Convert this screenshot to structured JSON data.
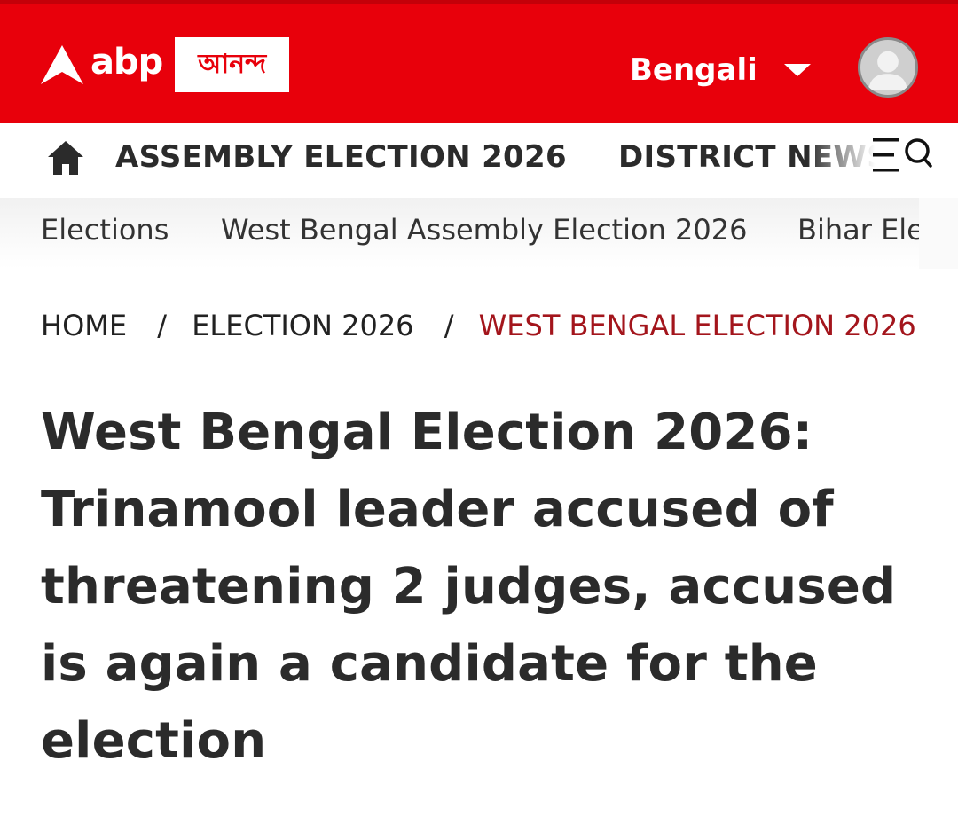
{
  "header": {
    "logo_text": "abp",
    "logo_badge": "আনন্দ",
    "language_label": "Bengali",
    "brand_color": "#e8000b"
  },
  "nav": {
    "items": [
      {
        "label": "ASSEMBLY ELECTION 2026"
      },
      {
        "label": "DISTRICT NEWS"
      }
    ],
    "icons": {
      "home": "home-icon",
      "menu": "menu-icon",
      "search": "search-icon"
    }
  },
  "subnav": {
    "items": [
      {
        "label": "Elections"
      },
      {
        "label": "West Bengal Assembly Election 2026"
      },
      {
        "label": "Bihar Ele"
      }
    ]
  },
  "breadcrumb": {
    "items": [
      {
        "label": "HOME"
      },
      {
        "label": "ELECTION 2026"
      },
      {
        "label": "WEST BENGAL ELECTION 2026:…"
      }
    ],
    "separator": "/",
    "current_color": "#a3151c"
  },
  "article": {
    "headline": "West Bengal Election 2026: Trinamool leader accused of threatening 2 judges, accused is again a candidate for the election"
  }
}
